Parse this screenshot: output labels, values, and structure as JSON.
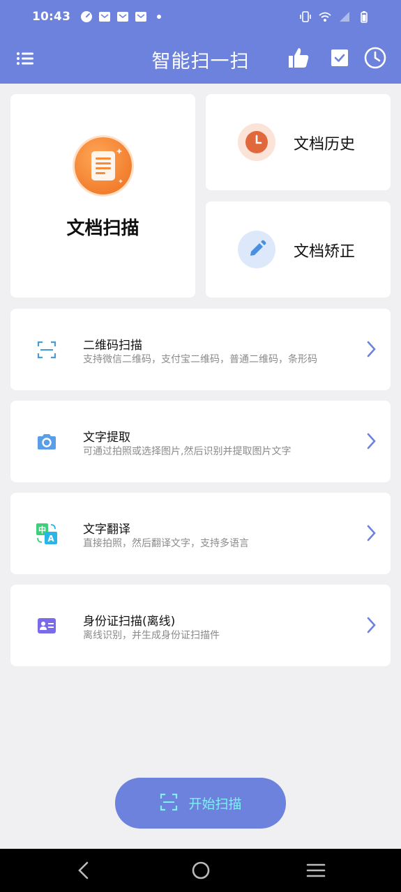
{
  "status_bar": {
    "time": "10:43",
    "left_icons": [
      "speedometer-icon",
      "mail-icon",
      "mail-icon",
      "mail-icon",
      "dot-icon"
    ],
    "right_icons": [
      "vibrate-icon",
      "wifi-icon",
      "signal-icon",
      "battery-icon"
    ]
  },
  "app_bar": {
    "title": "智能扫一扫",
    "actions": [
      "thumbs-up-icon",
      "checkbox-icon",
      "clock-icon"
    ]
  },
  "tiles": {
    "doc_scan": {
      "label": "文档扫描",
      "icon": "document-icon",
      "color": "#f08a3c"
    },
    "doc_history": {
      "label": "文档历史",
      "icon": "clock-icon",
      "color": "#e0683a"
    },
    "doc_correct": {
      "label": "文档矫正",
      "icon": "pencil-icon",
      "color": "#4a90e2"
    }
  },
  "features": [
    {
      "title": "二维码扫描",
      "subtitle": "支持微信二维码，支付宝二维码，普通二维码，条形码",
      "icon": "qr-scan-icon"
    },
    {
      "title": "文字提取",
      "subtitle": "可通过拍照或选择图片,然后识别并提取图片文字",
      "icon": "camera-icon"
    },
    {
      "title": "文字翻译",
      "subtitle": "直接拍照，然后翻译文字，支持多语言",
      "icon": "translate-icon"
    },
    {
      "title": "身份证扫描(离线)",
      "subtitle": "离线识别，并生成身份证扫描件",
      "icon": "id-card-icon"
    }
  ],
  "start_button": {
    "label": "开始扫描",
    "icon": "scan-icon"
  },
  "nav_bar": [
    "back-icon",
    "home-icon",
    "recents-icon"
  ],
  "colors": {
    "primary": "#6c82dd",
    "accent_text": "#7ff0f5",
    "background": "#f0f0f2"
  }
}
